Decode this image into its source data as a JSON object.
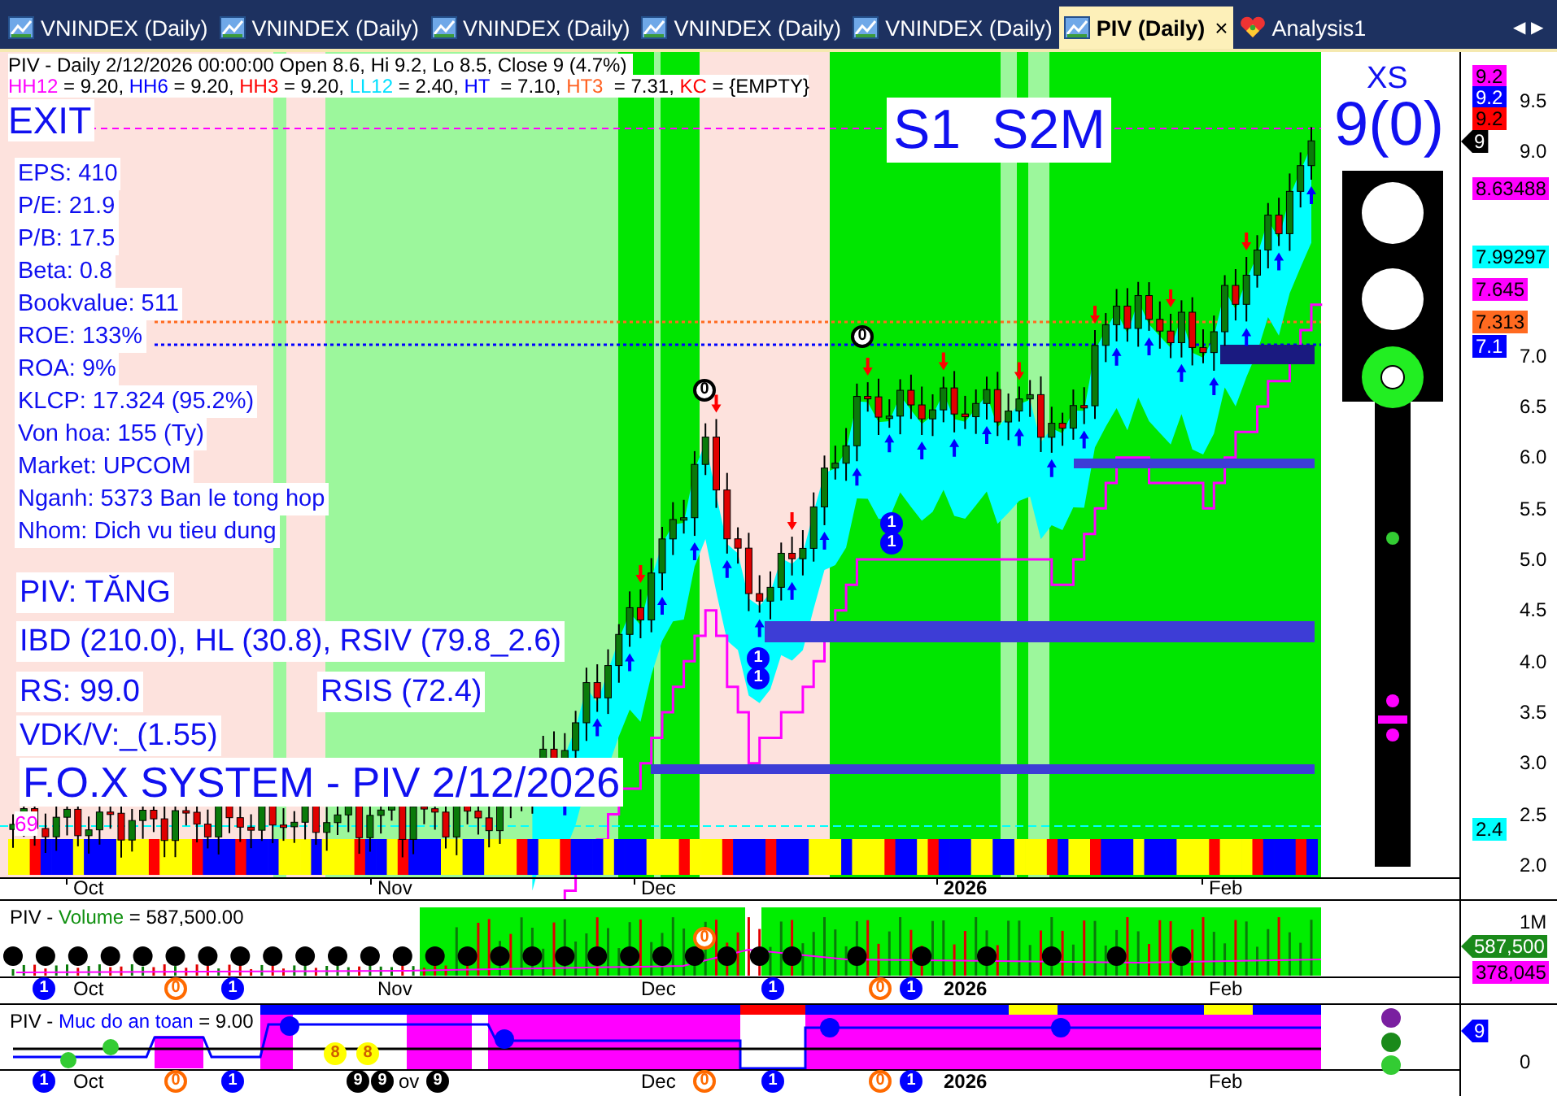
{
  "tabs": [
    {
      "label": "VNINDEX (Daily)",
      "selected": false,
      "kind": "chart"
    },
    {
      "label": "VNINDEX (Daily)",
      "selected": false,
      "kind": "chart"
    },
    {
      "label": "VNINDEX (Daily)",
      "selected": false,
      "kind": "chart"
    },
    {
      "label": "VNINDEX (Daily)",
      "selected": false,
      "kind": "chart"
    },
    {
      "label": "VNINDEX (Daily)",
      "selected": false,
      "kind": "chart"
    },
    {
      "label": "PIV (Daily)",
      "selected": true,
      "kind": "chart",
      "close": "×"
    },
    {
      "label": "Analysis1",
      "selected": false,
      "kind": "analysis"
    }
  ],
  "tab_scroll": [
    "◀",
    "▶"
  ],
  "price_pane": {
    "header": "PIV - Daily 2/12/2026 00:00:00 Open 8.6, Hi 9.2, Lo 8.5, Close 9 (4.7%)",
    "levels": [
      {
        "name": "HH12",
        "text": " = 9.20, ",
        "color": "#ff00ff"
      },
      {
        "name": "HH6",
        "text": " = 9.20, ",
        "color": "#0000ff"
      },
      {
        "name": "HH3",
        "text": " = 9.20, ",
        "color": "#ff0000"
      },
      {
        "name": "LL12",
        "text": " = 2.40, ",
        "color": "#00e0ff"
      },
      {
        "name": "HT",
        "text": "  = 7.10, ",
        "color": "#0000ff"
      },
      {
        "name": "HT3",
        "text": "  = 7.31, ",
        "color": "#ff6020"
      },
      {
        "name": "KC",
        "text": " = {EMPTY}",
        "color": "#ff0000"
      }
    ],
    "exit_label": "EXIT",
    "signal_label": "S1  S2M",
    "fundamentals": [
      "EPS: 410",
      "P/E: 21.9",
      "P/B: 17.5",
      "Beta: 0.8",
      "Bookvalue: 511",
      "ROE: 133%",
      "ROA: 9%",
      "KLCP: 17.324 (95.2%)",
      "Von hoa: 155 (Ty)",
      "Market: UPCOM",
      "Nganh: 5373 Ban le tong hop",
      "Nhom: Dich vu tieu dung"
    ],
    "trend": "PIV: TĂNG",
    "ratings": "IBD (210.0), HL (30.8), RSIV (79.8_2.6)",
    "rs": "RS: 99.0",
    "rsis": "RSIS (72.4)",
    "vdk": "VDK/V:_(1.55)",
    "title": "F.O.X SYSTEM - PIV 2/12/2026",
    "count": "69",
    "markers": [
      {
        "label": "0",
        "kind": "ring",
        "color": "#000000"
      },
      {
        "label": "0",
        "kind": "ring",
        "color": "#000000"
      },
      {
        "label": "1",
        "kind": "filled",
        "color": "#0000ff"
      },
      {
        "label": "1",
        "kind": "filled",
        "color": "#0000ff"
      },
      {
        "label": "1",
        "kind": "filled",
        "color": "#0000ff"
      },
      {
        "label": "1",
        "kind": "filled",
        "color": "#0000ff"
      }
    ],
    "xs_label": "XS",
    "xs_value": "9(0)",
    "axis_ticks": [
      "9.5",
      "9.0",
      "7.0",
      "6.5",
      "6.0",
      "5.5",
      "5.0",
      "4.5",
      "4.0",
      "3.5",
      "3.0",
      "2.5",
      "2.0"
    ],
    "value_tags": [
      {
        "label": "9.2",
        "color": "#ff00ff"
      },
      {
        "label": "9.2",
        "color": "#0000ff"
      },
      {
        "label": "9.2",
        "color": "#ff0000"
      },
      {
        "label": "9",
        "color": "#000000",
        "kind": "arrow"
      },
      {
        "label": "8.63488",
        "color": "#ff00ff"
      },
      {
        "label": "7.99297",
        "color": "#00ffff"
      },
      {
        "label": "7.645",
        "color": "#ff00ff"
      },
      {
        "label": "7.313",
        "color": "#ff6a20"
      },
      {
        "label": "7.1",
        "color": "#0000ff"
      },
      {
        "label": "2.4",
        "color": "#00ffff"
      }
    ],
    "dates": [
      {
        "label": "Oct",
        "bold": false
      },
      {
        "label": "Nov",
        "bold": false
      },
      {
        "label": "Dec",
        "bold": false
      },
      {
        "label": "2026",
        "bold": true
      },
      {
        "label": "Feb",
        "bold": false
      }
    ]
  },
  "volume_pane": {
    "title": [
      {
        "text": "PIV - ",
        "color": "#000000"
      },
      {
        "text": "Volume",
        "color": "#109010"
      },
      {
        "text": " = 587,500.00",
        "color": "#000000"
      }
    ],
    "axis_ticks": [
      "1M"
    ],
    "value_tags": [
      {
        "label": "587,500",
        "color": "#1a8a1a",
        "kind": "arrow"
      },
      {
        "label": "378,045",
        "color": "#ff00ff"
      }
    ],
    "markers": [
      {
        "label": "1",
        "kind": "filled",
        "color": "#0000ff"
      },
      {
        "label": "0",
        "kind": "ring",
        "color": "#ff6a00"
      },
      {
        "label": "1",
        "kind": "filled",
        "color": "#0000ff"
      },
      {
        "label": "0",
        "kind": "ring",
        "color": "#ff6a00"
      },
      {
        "label": "1",
        "kind": "filled",
        "color": "#0000ff"
      },
      {
        "label": "0",
        "kind": "ring",
        "color": "#ff6a00"
      },
      {
        "label": "1",
        "kind": "filled",
        "color": "#0000ff"
      }
    ],
    "dates": [
      {
        "label": "Oct",
        "bold": false
      },
      {
        "label": "Nov",
        "bold": false
      },
      {
        "label": "Dec",
        "bold": false
      },
      {
        "label": "2026",
        "bold": true
      },
      {
        "label": "Feb",
        "bold": false
      }
    ]
  },
  "safety_pane": {
    "title": [
      {
        "text": "PIV - ",
        "color": "#000000"
      },
      {
        "text": "Muc do an toan",
        "color": "#0000ff"
      },
      {
        "text": " = 9.00",
        "color": "#000000"
      }
    ],
    "axis_ticks": [
      "0"
    ],
    "value_tags": [
      {
        "label": "9",
        "color": "#0000ff",
        "kind": "arrow"
      }
    ],
    "status_dots": [
      {
        "color": "#7a1fa0"
      },
      {
        "color": "#1a8a1a"
      },
      {
        "color": "#33cc33"
      }
    ],
    "markers": [
      {
        "label": "1",
        "kind": "filled",
        "color": "#0000ff"
      },
      {
        "label": "0",
        "kind": "ring",
        "color": "#ff6a00"
      },
      {
        "label": "1",
        "kind": "filled",
        "color": "#0000ff"
      },
      {
        "label": "8",
        "kind": "badge",
        "color": "#ffff00"
      },
      {
        "label": "8",
        "kind": "badge",
        "color": "#ffff00"
      },
      {
        "label": "9",
        "kind": "filled",
        "color": "#000000"
      },
      {
        "label": "9",
        "kind": "filled",
        "color": "#000000"
      },
      {
        "label": "9",
        "kind": "filled",
        "color": "#000000"
      },
      {
        "label": "0",
        "kind": "ring",
        "color": "#ff6a00"
      },
      {
        "label": "1",
        "kind": "filled",
        "color": "#0000ff"
      },
      {
        "label": "0",
        "kind": "ring",
        "color": "#ff6a00"
      },
      {
        "label": "1",
        "kind": "filled",
        "color": "#0000ff"
      }
    ],
    "dates": [
      {
        "label": "Oct",
        "bold": false
      },
      {
        "label": "ov",
        "bold": false
      },
      {
        "label": "Dec",
        "bold": false
      },
      {
        "label": "2026",
        "bold": true
      },
      {
        "label": "Feb",
        "bold": false
      }
    ]
  }
}
